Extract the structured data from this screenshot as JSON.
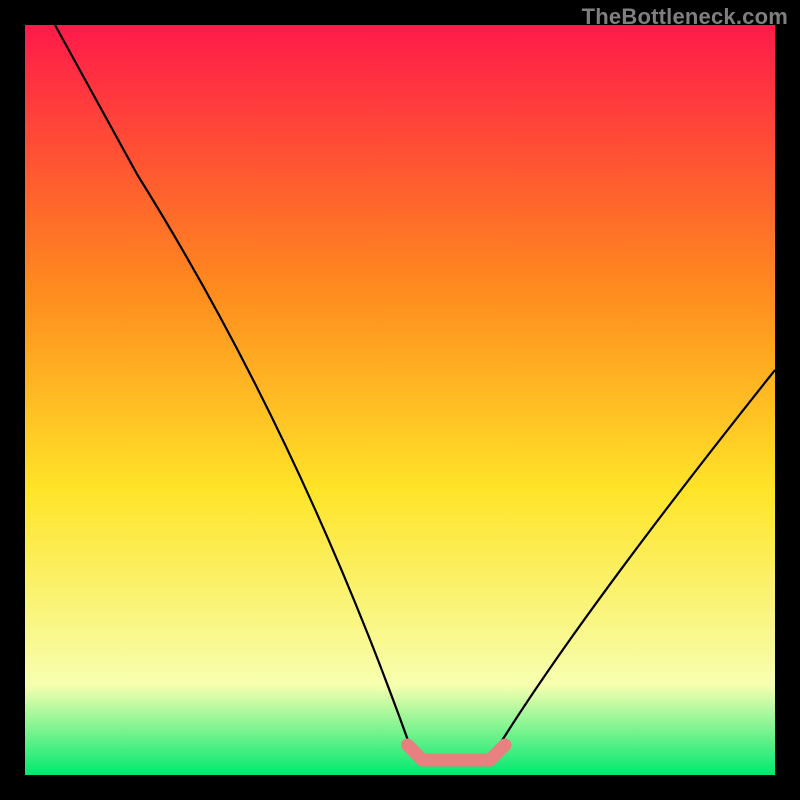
{
  "watermark": "TheBottleneck.com",
  "colors": {
    "frame": "#000000",
    "gradient_top": "#ff1a4a",
    "gradient_upper_mid": "#ff8a1e",
    "gradient_mid": "#ffe428",
    "gradient_lower_mid": "#f7ffb0",
    "gradient_bottom": "#00e86f",
    "curve": "#000000",
    "highlight": "#e98080"
  },
  "chart_data": {
    "type": "line",
    "title": "",
    "xlabel": "",
    "ylabel": "",
    "xlim": [
      0,
      100
    ],
    "ylim": [
      0,
      100
    ],
    "series": [
      {
        "name": "bottleneck-curve",
        "points": [
          {
            "x": 4,
            "y": 100
          },
          {
            "x": 15,
            "y": 80
          },
          {
            "x": 52,
            "y": 2
          },
          {
            "x": 62,
            "y": 2
          },
          {
            "x": 100,
            "y": 54
          }
        ]
      },
      {
        "name": "highlight-segment",
        "points": [
          {
            "x": 51,
            "y": 4
          },
          {
            "x": 53,
            "y": 2
          },
          {
            "x": 62,
            "y": 2
          },
          {
            "x": 64,
            "y": 4
          }
        ]
      }
    ]
  }
}
